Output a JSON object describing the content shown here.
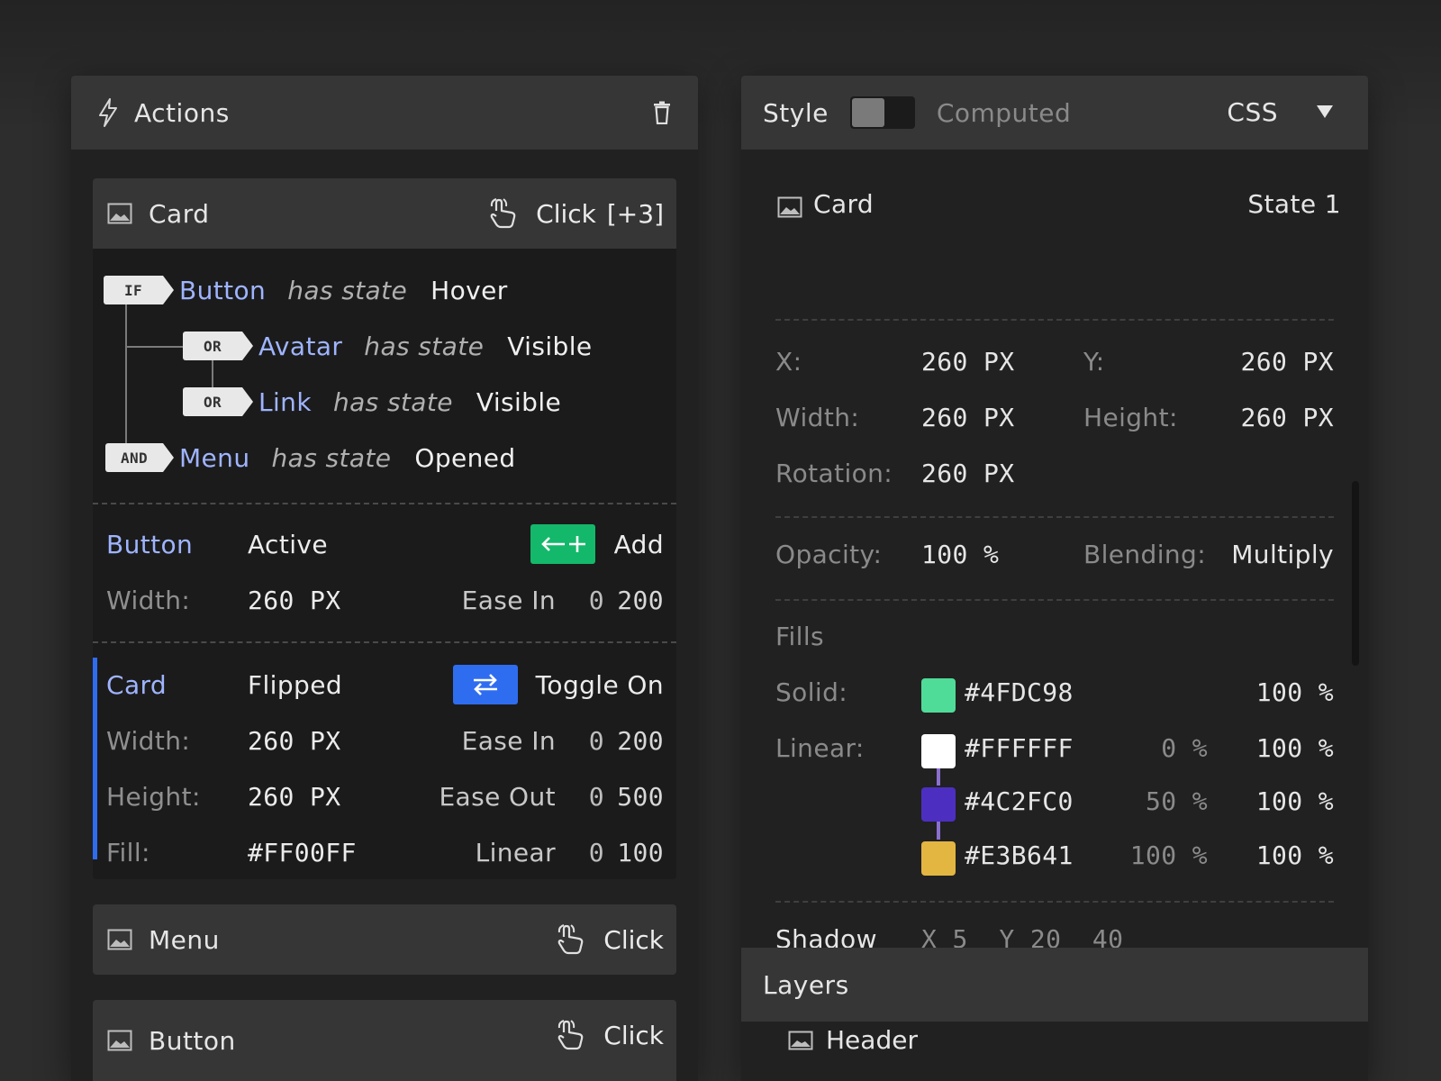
{
  "actions_panel": {
    "title": "Actions",
    "cards": [
      {
        "title": "Card",
        "trigger": "Click",
        "trigger_extra": "[+3]",
        "conditions": [
          {
            "tag": "IF",
            "target": "Button",
            "verb": "has state",
            "state": "Hover"
          },
          {
            "tag": "OR",
            "target": "Avatar",
            "verb": "has state",
            "state": "Visible"
          },
          {
            "tag": "OR",
            "target": "Link",
            "verb": "has state",
            "state": "Visible"
          },
          {
            "tag": "AND",
            "target": "Menu",
            "verb": "has state",
            "state": "Opened"
          }
        ],
        "actions": [
          {
            "target": "Button",
            "state": "Active",
            "operation": "Add",
            "op_icon": "arrow-add-icon",
            "op_color": "#14b86a",
            "rows": [
              {
                "label": "Width:",
                "value": "260 PX",
                "ease": "Ease In",
                "n1": "0",
                "n2": "200"
              }
            ]
          },
          {
            "target": "Card",
            "state": "Flipped",
            "operation": "Toggle On",
            "op_icon": "swap-arrows-icon",
            "op_color": "#2f6df0",
            "rows": [
              {
                "label": "Width:",
                "value": "260 PX",
                "ease": "Ease In",
                "n1": "0",
                "n2": "200"
              },
              {
                "label": "Height:",
                "value": "260 PX",
                "ease": "Ease Out",
                "n1": "0",
                "n2": "500"
              },
              {
                "label": "Fill:",
                "value": "#FF00FF",
                "ease": "Linear",
                "n1": "0",
                "n2": "100"
              }
            ]
          }
        ]
      },
      {
        "title": "Menu",
        "trigger": "Click"
      },
      {
        "title": "Button",
        "trigger": "Click"
      }
    ]
  },
  "style_panel": {
    "tab_style": "Style",
    "tab_computed": "Computed",
    "css_label": "CSS",
    "element": {
      "name": "Card",
      "state": "State 1"
    },
    "transform": {
      "x_label": "X:",
      "x_value": "260 PX",
      "y_label": "Y:",
      "y_value": "260 PX",
      "width_label": "Width:",
      "width_value": "260 PX",
      "height_label": "Height:",
      "height_value": "260 PX",
      "rotation_label": "Rotation:",
      "rotation_value": "260 PX"
    },
    "appearance": {
      "opacity_label": "Opacity:",
      "opacity_value": "100 %",
      "blending_label": "Blending:",
      "blending_value": "Multiply"
    },
    "fills": {
      "title": "Fills",
      "solid": {
        "label": "Solid:",
        "color": "#4FDC98",
        "opacity": "100 %"
      },
      "linear": {
        "label": "Linear:",
        "stops": [
          {
            "color": "#FFFFFF",
            "position": "0 %",
            "opacity": "100 %"
          },
          {
            "color": "#4C2FC0",
            "position": "50 %",
            "opacity": "100 %"
          },
          {
            "color": "#E3B641",
            "position": "100 %",
            "opacity": "100 %"
          }
        ]
      }
    },
    "shadow": {
      "label": "Shadow",
      "x_label": "X",
      "x": "5",
      "y_label": "Y",
      "y": "20",
      "blur": "40"
    },
    "layers": {
      "title": "Layers",
      "items": [
        "Header"
      ]
    }
  },
  "colors": {
    "accent_blue": "#2f6df0",
    "accent_green": "#14b86a",
    "link_text": "#9fb4ff"
  }
}
